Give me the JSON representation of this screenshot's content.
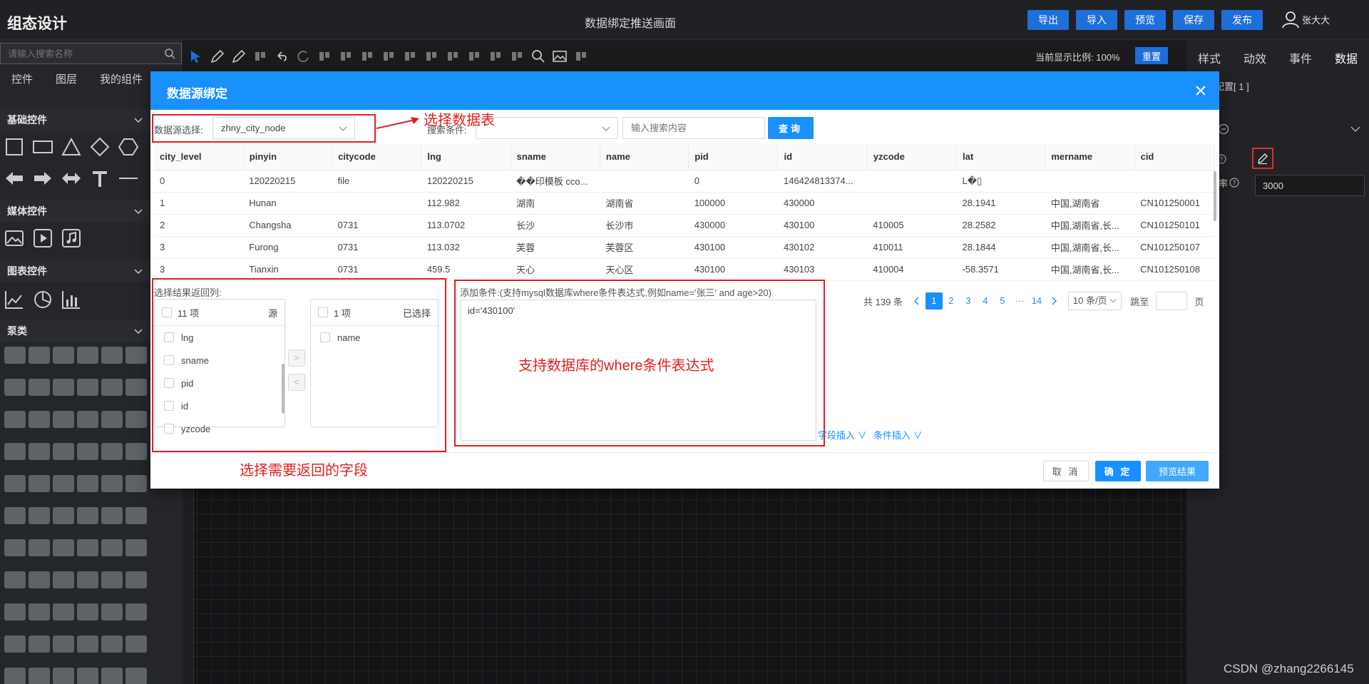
{
  "header": {
    "app_title": "组态设计",
    "page_title": "数据绑定推送画面",
    "actions": [
      "导出",
      "导入",
      "预览",
      "保存",
      "发布"
    ],
    "user_name": "张大大"
  },
  "left_panel": {
    "search_placeholder": "请输入搜索名称",
    "tabs": [
      "控件",
      "图层",
      "我的组件"
    ],
    "categories": {
      "basic": "基础控件",
      "media": "媒体控件",
      "chart": "图表控件",
      "pump": "泵类"
    }
  },
  "toolbar": {
    "zoom_label": "当前显示比例:",
    "zoom_value": "100%",
    "reset_label": "重置"
  },
  "right_panel": {
    "tabs": [
      "样式",
      "动效",
      "事件",
      "数据"
    ],
    "config_label": "配置[ 1 ]",
    "rate_label": "率",
    "rate_value": "3000"
  },
  "modal": {
    "title": "数据源绑定",
    "source_label": "数据源选择:",
    "source_value": "zhny_city_node",
    "search_cond_label": "搜索条件:",
    "search_placeholder": "输入搜索内容",
    "query_button": "查询",
    "table": {
      "columns": [
        "city_level",
        "pinyin",
        "citycode",
        "lng",
        "sname",
        "name",
        "pid",
        "id",
        "yzcode",
        "lat",
        "mername",
        "cid"
      ],
      "rows": [
        [
          "0",
          "120220215",
          "file",
          "120220215",
          "��印模板 cco...",
          "",
          "0",
          "146424813374...",
          "",
          "L�▯",
          "",
          ""
        ],
        [
          "1",
          "Hunan",
          "",
          "112.982",
          "湖南",
          "湖南省",
          "100000",
          "430000",
          "",
          "28.1941",
          "中国,湖南省",
          "CN101250001"
        ],
        [
          "2",
          "Changsha",
          "0731",
          "113.0702",
          "长沙",
          "长沙市",
          "430000",
          "430100",
          "410005",
          "28.2582",
          "中国,湖南省,长...",
          "CN101250101"
        ],
        [
          "3",
          "Furong",
          "0731",
          "113.032",
          "芙蓉",
          "芙蓉区",
          "430100",
          "430102",
          "410011",
          "28.1844",
          "中国,湖南省,长...",
          "CN101250107"
        ],
        [
          "3",
          "Tianxin",
          "0731",
          "459.5",
          "天心",
          "天心区",
          "430100",
          "430103",
          "410004",
          "-58.3571",
          "中国,湖南省,长...",
          "CN101250108"
        ]
      ]
    },
    "transfer": {
      "label": "选择结果返回列:",
      "source_count": "11 项",
      "source_title": "源",
      "source_items": [
        "lng",
        "sname",
        "pid",
        "id",
        "yzcode"
      ],
      "target_count": "1 项",
      "target_title": "已选择",
      "target_items": [
        "name"
      ],
      "move_right": ">",
      "move_left": "<"
    },
    "condition": {
      "label": "添加条件:(支持mysql数据库where条件表达式,例如name='张三' and age>20)",
      "value": "id='430100'",
      "field_insert": "字段插入 ∨",
      "cond_insert": "条件插入 ∨"
    },
    "pagination": {
      "total": "共 139 条",
      "pages": [
        "1",
        "2",
        "3",
        "4",
        "5",
        "···",
        "14"
      ],
      "current": "1",
      "page_size": "10 条/页",
      "jump_label": "跳至",
      "page_unit": "页"
    },
    "footer": {
      "cancel": "取 消",
      "ok": "确 定",
      "preview": "预览结果"
    }
  },
  "annotations": {
    "select_table": "选择数据表",
    "where_support": "支持数据库的where条件表达式",
    "select_fields": "选择需要返回的字段"
  },
  "watermark": "CSDN @zhang2266145",
  "colors": {
    "primary": "#1890ff",
    "annotation": "#e02020",
    "dark_bg": "#1b1b1d"
  },
  "icons": [
    "search-icon",
    "user-icon",
    "close-icon",
    "chevron-down-icon",
    "edit-icon",
    "question-icon"
  ]
}
